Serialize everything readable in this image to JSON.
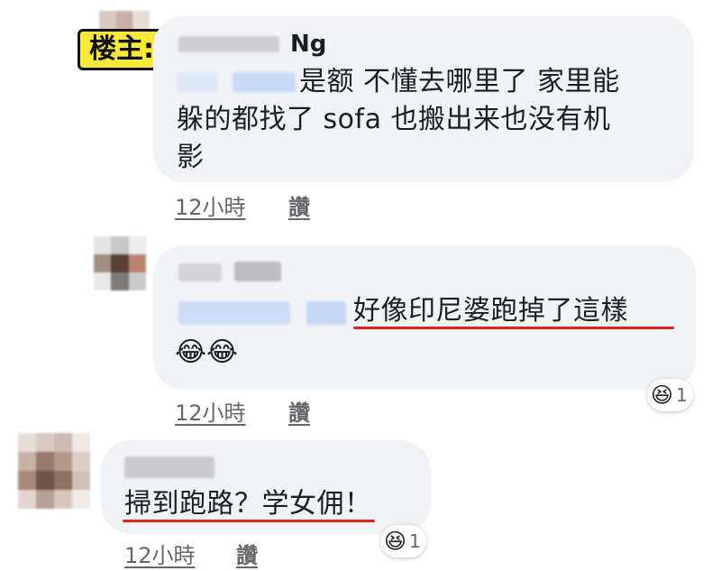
{
  "comments": [
    {
      "name_suffix": "Ng",
      "text_line1": "是额  不懂去哪里了 家里能",
      "text_line2": "躲的都找了 sofa 也搬出来也没有机",
      "text_line3": "影",
      "time": "12小時",
      "like": "讚"
    },
    {
      "text_line1": "好像印尼婆跑掉了這樣",
      "emoji": "😂😂",
      "time": "12小時",
      "like": "讚",
      "reaction_emoji": "😆",
      "reaction_count": "1"
    },
    {
      "text_line1": "掃到跑路？学女佣！",
      "time": "12小時",
      "like": "讚",
      "reaction_emoji": "😆",
      "reaction_count": "1"
    }
  ],
  "label": {
    "op_badge": "楼主:"
  },
  "colors": {
    "bubble": "#f0f2f5",
    "underline": "#e0231d",
    "badge_bg": "#f7e93a",
    "meta": "#65676b"
  }
}
